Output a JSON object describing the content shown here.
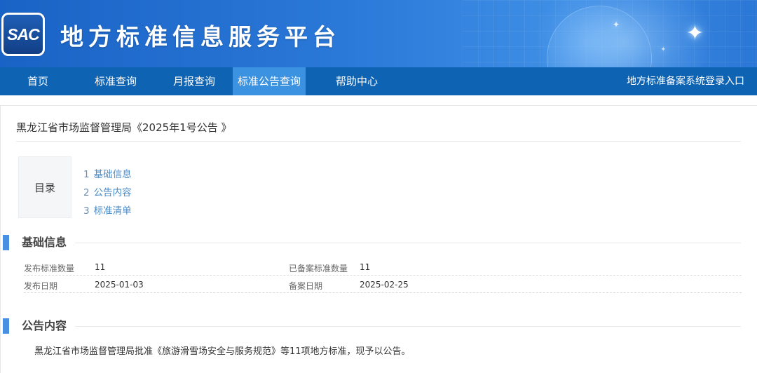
{
  "header": {
    "logo_text": "SAC",
    "site_title": "地方标准信息服务平台"
  },
  "nav": {
    "items": [
      {
        "label": "首页",
        "active": false
      },
      {
        "label": "标准查询",
        "active": false
      },
      {
        "label": "月报查询",
        "active": false
      },
      {
        "label": "标准公告查询",
        "active": true
      },
      {
        "label": "帮助中心",
        "active": false
      }
    ],
    "login_link": "地方标准备案系统登录入口"
  },
  "page": {
    "title": "黑龙江省市场监督管理局《2025年1号公告 》"
  },
  "toc": {
    "heading": "目录",
    "items": [
      {
        "num": "1",
        "label": "基础信息"
      },
      {
        "num": "2",
        "label": "公告内容"
      },
      {
        "num": "3",
        "label": "标准清单"
      }
    ]
  },
  "basic_info": {
    "heading": "基础信息",
    "rows": [
      {
        "label1": "发布标准数量",
        "value1": "11",
        "label2": "已备案标准数量",
        "value2": "11"
      },
      {
        "label1": "发布日期",
        "value1": "2025-01-03",
        "label2": "备案日期",
        "value2": "2025-02-25"
      }
    ]
  },
  "announcement": {
    "heading": "公告内容",
    "text": "黑龙江省市场监督管理局批准《旅游滑雪场安全与服务规范》等11项地方标准，现予以公告。"
  },
  "colors": {
    "nav_bg": "#0f63b3",
    "nav_active": "#3a92e0",
    "section_bar": "#4a90e2",
    "link": "#4a8bc6"
  }
}
